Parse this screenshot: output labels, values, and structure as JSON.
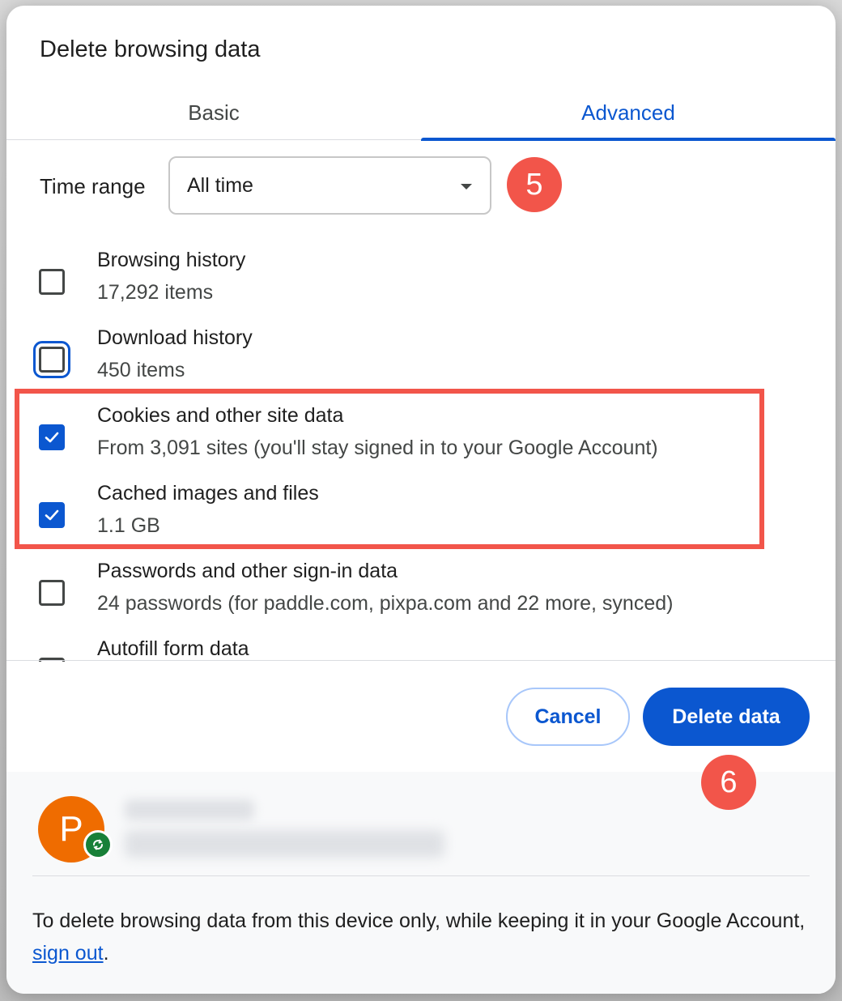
{
  "dialog": {
    "title": "Delete browsing data"
  },
  "tabs": [
    {
      "label": "Basic",
      "active": false
    },
    {
      "label": "Advanced",
      "active": true
    }
  ],
  "time_range": {
    "label": "Time range",
    "selected": "All time"
  },
  "items": [
    {
      "title": "Browsing history",
      "sub": "17,292 items",
      "checked": false
    },
    {
      "title": "Download history",
      "sub": "450 items",
      "checked": false,
      "focused": true
    },
    {
      "title": "Cookies and other site data",
      "sub": "From 3,091 sites (you'll stay signed in to your Google Account)",
      "checked": true
    },
    {
      "title": "Cached images and files",
      "sub": "1.1 GB",
      "checked": true
    },
    {
      "title": "Passwords and other sign-in data",
      "sub": "24 passwords (for paddle.com, pixpa.com and 22 more, synced)",
      "checked": false
    },
    {
      "title": "Autofill form data",
      "sub": "",
      "checked": false
    }
  ],
  "buttons": {
    "cancel": "Cancel",
    "delete": "Delete data"
  },
  "annotations": {
    "step5": "5",
    "step6": "6",
    "highlight_color": "#f2554a"
  },
  "account": {
    "avatar_letter": "P",
    "avatar_color": "#ef6c00"
  },
  "footer": {
    "text_before": "To delete browsing data from this device only, while keeping it in your Google Account, ",
    "link": "sign out",
    "text_after": "."
  },
  "colors": {
    "accent": "#0b57d0"
  }
}
